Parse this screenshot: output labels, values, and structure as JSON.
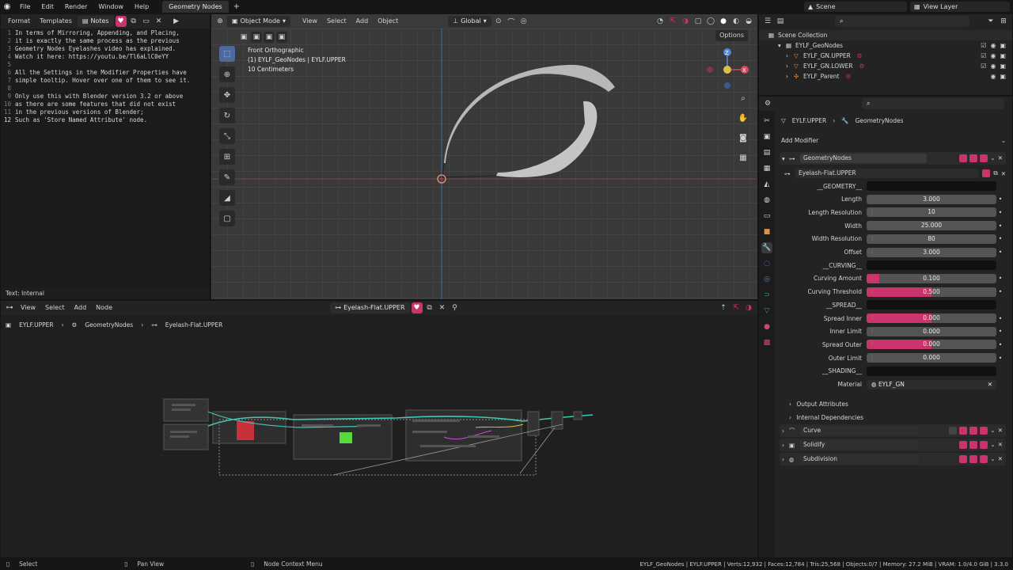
{
  "topbar": {
    "menus": [
      "File",
      "Edit",
      "Render",
      "Window",
      "Help"
    ],
    "workspace_tab": "Geometry Nodes",
    "scene": "Scene",
    "view_layer": "View Layer"
  },
  "text_editor": {
    "menus": [
      "Format",
      "Templates"
    ],
    "file_name": "Notes",
    "lines": [
      "In terms of Mirroring, Appending, and Placing,",
      "it is exactly the same process as the previous",
      "Geometry Nodes Eyelashes video has explained.",
      "Watch it here: https://youtu.be/Tl6aLlC0eYY",
      "",
      "All the Settings in the Modifier Properties have",
      "simple tooltip. Hover over one of them to see it.",
      "",
      "Only use this with Blender version 3.2 or above",
      "as there are some features that did not exist",
      "in the previous versions of Blender;",
      "Such as 'Store Named Attribute' node."
    ],
    "footer": "Text: Internal"
  },
  "viewport": {
    "mode": "Object Mode",
    "menus": [
      "View",
      "Select",
      "Add",
      "Object"
    ],
    "orientation": "Global",
    "options": "Options",
    "overlay_title": "Front Orthographic",
    "overlay_object": "(1) EYLF_GeoNodes | EYLF.UPPER",
    "overlay_scale": "10 Centimeters",
    "gizmo_z": "Z",
    "gizmo_x": "X"
  },
  "node_editor": {
    "menus": [
      "View",
      "Select",
      "Add",
      "Node"
    ],
    "node_group": "Eyelash-Flat.UPPER",
    "breadcrumbs": [
      "EYLF.UPPER",
      "GeometryNodes",
      "Eyelash-Flat.UPPER"
    ]
  },
  "outliner": {
    "items": [
      {
        "label": "Scene Collection"
      },
      {
        "label": "EYLF_GeoNodes"
      },
      {
        "label": "EYLF_GN.UPPER"
      },
      {
        "label": "EYLF_GN.LOWER"
      },
      {
        "label": "EYLF_Parent"
      }
    ]
  },
  "properties": {
    "breadcrumb_object": "EYLF.UPPER",
    "breadcrumb_modifier": "GeometryNodes",
    "add_modifier": "Add Modifier",
    "modifier_name": "GeometryNodes",
    "node_group": "Eyelash-Flat.UPPER",
    "rows": [
      {
        "type": "section",
        "label": "__GEOMETRY__"
      },
      {
        "type": "field",
        "label": "Length",
        "value": "3.000",
        "fill": 0,
        "grip": false
      },
      {
        "type": "field",
        "label": "Length Resolution",
        "value": "10",
        "fill": 0,
        "grip": true
      },
      {
        "type": "field",
        "label": "Width",
        "value": "25.000",
        "fill": 0,
        "grip": false
      },
      {
        "type": "field",
        "label": "Width Resolution",
        "value": "80",
        "fill": 0,
        "grip": true
      },
      {
        "type": "field",
        "label": "Offset",
        "value": "3.000",
        "fill": 0,
        "grip": true
      },
      {
        "type": "section",
        "label": "__CURVING__"
      },
      {
        "type": "field",
        "label": "Curving Amount",
        "value": "0.100",
        "fill": 0.1,
        "grip": true
      },
      {
        "type": "field",
        "label": "Curving Threshold",
        "value": "0.500",
        "fill": 0.5,
        "grip": true
      },
      {
        "type": "section",
        "label": "__SPREAD__"
      },
      {
        "type": "field",
        "label": "Spread Inner",
        "value": "0.000",
        "fill": 0.5,
        "grip": true
      },
      {
        "type": "field",
        "label": "Inner Limit",
        "value": "0.000",
        "fill": 0,
        "grip": true
      },
      {
        "type": "field",
        "label": "Spread Outer",
        "value": "0.000",
        "fill": 0.5,
        "grip": true
      },
      {
        "type": "field",
        "label": "Outer Limit",
        "value": "0.000",
        "fill": 0,
        "grip": true
      },
      {
        "type": "section",
        "label": "__SHADING__"
      },
      {
        "type": "material",
        "label": "Material",
        "value": "EYLF_GN"
      }
    ],
    "output_attributes": "Output Attributes",
    "internal_dependencies": "Internal Dependencies",
    "modifiers": [
      "Curve",
      "Solidify",
      "Subdivision"
    ]
  },
  "statusbar": {
    "select": "Select",
    "pan": "Pan View",
    "context": "Node Context Menu",
    "stats": "EYLF_GeoNodes | EYLF.UPPER | Verts:12,932 | Faces:12,784 | Tris:25,568 | Objects:0/7 | Memory: 27.2 MiB | VRAM: 1.0/4.0 GiB | 3.3.0"
  },
  "colors": {
    "accent": "#c9346c",
    "node_wire": "#3fc8b4",
    "active_tab": "#4a6aa0"
  }
}
